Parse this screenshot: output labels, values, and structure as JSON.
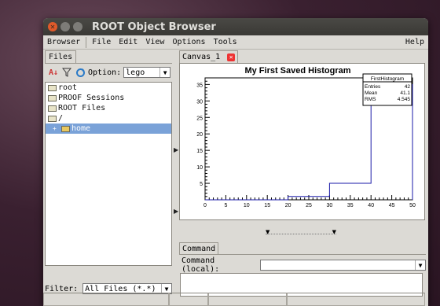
{
  "window": {
    "title": "ROOT Object Browser"
  },
  "menu": {
    "browser": "Browser",
    "file": "File",
    "edit": "Edit",
    "view": "View",
    "options": "Options",
    "tools": "Tools",
    "help": "Help"
  },
  "files_tab": "Files",
  "option_label": "Option:",
  "option_value": "lego",
  "tree": [
    {
      "label": "root",
      "selected": false
    },
    {
      "label": "PROOF Sessions",
      "selected": false
    },
    {
      "label": "ROOT Files",
      "selected": false
    },
    {
      "label": "/",
      "selected": false
    },
    {
      "label": "home",
      "selected": true,
      "expander": "+"
    }
  ],
  "filter": {
    "label": "Filter:",
    "value": "All Files (*.*)"
  },
  "canvas_tab": "Canvas_1",
  "chart_data": {
    "type": "bar",
    "title": "My First Saved Histogram",
    "bins": [
      {
        "x0": 0,
        "x1": 20,
        "y": 0
      },
      {
        "x0": 20,
        "x1": 30,
        "y": 1
      },
      {
        "x0": 30,
        "x1": 40,
        "y": 5
      },
      {
        "x0": 40,
        "x1": 50,
        "y": 35
      }
    ],
    "xlim": [
      0,
      50
    ],
    "ylim": [
      0,
      37
    ],
    "xticks": [
      "0",
      "5",
      "10",
      "15",
      "20",
      "25",
      "30",
      "35",
      "40",
      "45",
      "50"
    ],
    "yticks": [
      "5",
      "10",
      "15",
      "20",
      "25",
      "30",
      "35"
    ],
    "stats": {
      "name": "FirstHistogram",
      "rows": [
        [
          "Entries",
          "42"
        ],
        [
          "Mean",
          "41.1"
        ],
        [
          "RMS",
          "4.545"
        ]
      ]
    },
    "line_color": "#1a1aa8"
  },
  "command": {
    "tab": "Command",
    "label": "Command (local):"
  }
}
